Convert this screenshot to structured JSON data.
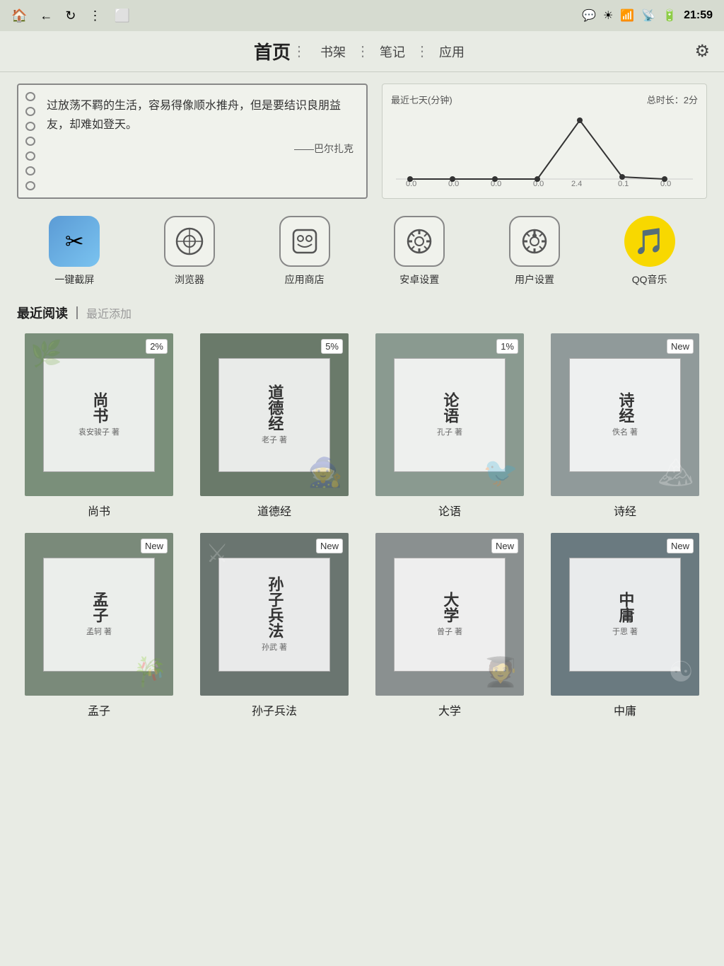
{
  "statusBar": {
    "time": "21:59",
    "icons": [
      "home",
      "back",
      "refresh",
      "more",
      "screen"
    ]
  },
  "navBar": {
    "title": "首页",
    "items": [
      "书架",
      "笔记",
      "应用"
    ],
    "settingsIcon": "⚙"
  },
  "quote": {
    "text": "过放荡不羁的生活，容易得像顺水推舟，但是要结识良朋益友，却难如登天。",
    "author": "——巴尔扎克"
  },
  "chart": {
    "title": "最近七天(分钟)",
    "total": "总时长：2分",
    "labels": [
      "0.0",
      "0.0",
      "0.0",
      "0.0",
      "2.4",
      "0.1",
      "0.0"
    ],
    "values": [
      0,
      0,
      0,
      0,
      2.4,
      0.1,
      0
    ]
  },
  "apps": [
    {
      "name": "一键截屏",
      "type": "scissors"
    },
    {
      "name": "浏览器",
      "type": "browser"
    },
    {
      "name": "应用商店",
      "type": "store"
    },
    {
      "name": "安卓设置",
      "type": "android"
    },
    {
      "name": "用户设置",
      "type": "user"
    },
    {
      "name": "QQ音乐",
      "type": "qq"
    }
  ],
  "booksSection": {
    "recentRead": "最近阅读",
    "recentAdded": "最近添加"
  },
  "books": [
    {
      "title": "尚书",
      "titleChar": "尚书",
      "author": "袁安骏子 著",
      "badge": "2%",
      "bg": "1",
      "label": "尚书"
    },
    {
      "title": "道德经",
      "titleChar": "道德经",
      "author": "老子 著",
      "badge": "5%",
      "bg": "2",
      "label": "道德经"
    },
    {
      "title": "论语",
      "titleChar": "论语",
      "author": "孔子 著",
      "badge": "1%",
      "bg": "3",
      "label": "论语"
    },
    {
      "title": "诗经",
      "titleChar": "诗经",
      "author": "佚名 著",
      "badge": "New",
      "bg": "4",
      "label": "诗经"
    },
    {
      "title": "孟子",
      "titleChar": "孟子",
      "author": "孟轲 著",
      "badge": "New",
      "bg": "5",
      "label": "孟子"
    },
    {
      "title": "孙子兵法",
      "titleChar": "孙子兵法",
      "author": "孙武 著",
      "badge": "New",
      "bg": "6",
      "label": "孙子兵法"
    },
    {
      "title": "大学",
      "titleChar": "大学",
      "author": "曾子 著",
      "badge": "New",
      "bg": "7",
      "label": "大学"
    },
    {
      "title": "中庸",
      "titleChar": "中庸",
      "author": "于思 著",
      "badge": "New",
      "bg": "8",
      "label": "中庸"
    }
  ]
}
